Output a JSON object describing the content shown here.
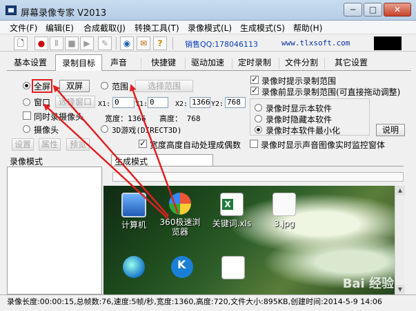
{
  "window": {
    "title": "屏幕录像专家 V2013",
    "controls": {
      "minimize": "─",
      "maximize": "□",
      "close": "✕"
    }
  },
  "menu": [
    "文件(F)",
    "编辑(E)",
    "合成截取(J)",
    "转换工具(T)",
    "录像模式(L)",
    "生成模式(S)",
    "帮助(H)"
  ],
  "toolbar": {
    "sales_qq": "销售QQ:178046113",
    "website": "www.tlxsoft.com",
    "icons": [
      "new-icon",
      "record-icon",
      "pause-icon",
      "stop-icon",
      "play-icon",
      "pen-icon",
      "globe-icon",
      "gift-icon",
      "help-icon"
    ]
  },
  "tabs": [
    "基本设置",
    "录制目标",
    "声音",
    "快捷键",
    "驱动加速",
    "定时录制",
    "文件分割",
    "其它设置"
  ],
  "panel": {
    "radio_fullscreen": "全屏",
    "btn_dual": "双屏",
    "radio_range": "范围",
    "btn_select_range": "选择范围",
    "radio_window": "窗口",
    "btn_select_window": "选择窗口",
    "x1_label": "X1:",
    "x1_value": "0",
    "y1_label": "Y1:",
    "y1_value": "0",
    "x2_label": "X2:",
    "x2_value": "1366",
    "y2_label": "Y2:",
    "y2_value": "768",
    "check_camera_simul": "同时录摄像头",
    "width_label": "宽度：1366",
    "height_label": "高度：  768",
    "radio_camera": "摄像头",
    "radio_3dgame": "3D游戏(DIRECT3D)",
    "btn_settings": "设置",
    "btn_props": "属性",
    "btn_preview": "预览",
    "check_auto_even": "宽度高度自动处理成偶数",
    "check_show_range_while": "录像时提示录制范围",
    "check_show_range_before": "录像前显示录制范围(可直接拖动调整)",
    "radio_show_soft": "录像时显示本软件",
    "radio_hide_soft": "录像时隐藏本软件",
    "radio_minimize_soft": "录像时本软件最小化",
    "btn_explain": "说明",
    "check_realtime_monitor": "录像时显示声音图像实时监控窗体"
  },
  "lower": {
    "record_mode_label": "录像模式",
    "generate_mode_label": "生成模式"
  },
  "desktop_icons": [
    {
      "label": "计算机",
      "icon": "computer-icon"
    },
    {
      "label": "360极速浏览器",
      "icon": "browser-icon"
    },
    {
      "label": "关键词.xls",
      "icon": "excel-file-icon"
    },
    {
      "label": "3.jpg",
      "icon": "image-file-icon"
    },
    {
      "label": "",
      "icon": "network-icon"
    },
    {
      "label": "",
      "icon": "kugou-icon"
    },
    {
      "label": "",
      "icon": "document-icon"
    }
  ],
  "watermark": "Bai 经验",
  "status": "录像长度:00:00:15,总帧数:76,速度:5帧/秒,宽度:1360,高度:720,文件大小:895KB,创建时间:2014-5-9 14:06",
  "colors": {
    "annotation_red": "#e02020",
    "title_bar": "#c9dcef"
  }
}
